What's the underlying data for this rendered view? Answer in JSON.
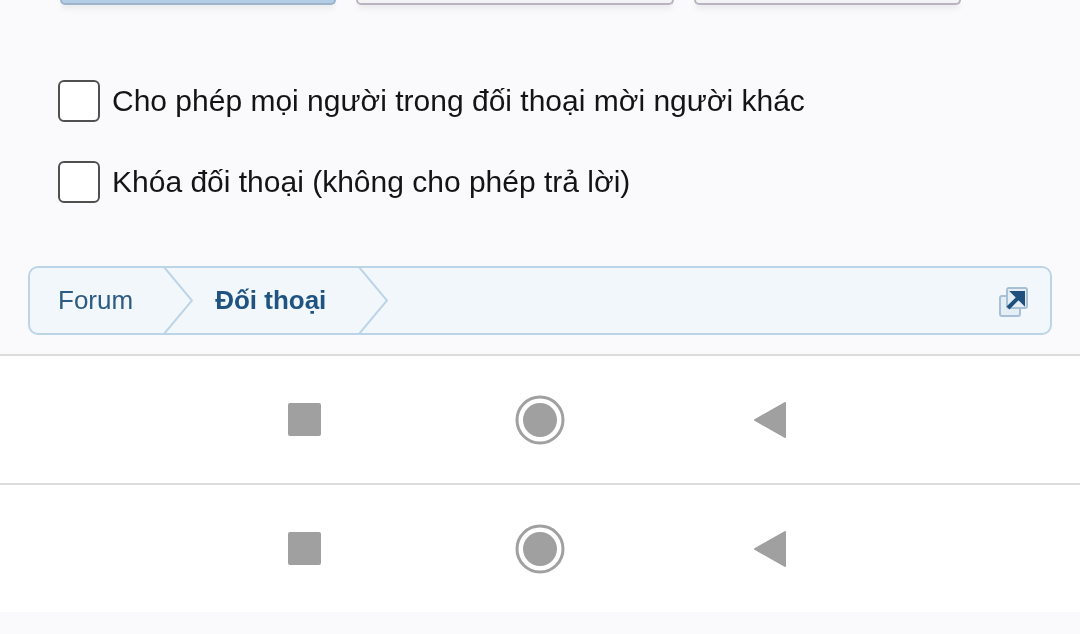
{
  "top_buttons": [
    {
      "selected": true
    },
    {
      "selected": false
    },
    {
      "selected": false
    }
  ],
  "options": [
    {
      "label": "Cho phép mọi người trong đối thoại mời người khác",
      "checked": false
    },
    {
      "label": "Khóa đối thoại (không cho phép trả lời)",
      "checked": false
    }
  ],
  "breadcrumb": [
    {
      "label": "Forum",
      "selected": false
    },
    {
      "label": "Đối thoại",
      "selected": true
    }
  ],
  "nav_bars": [
    {
      "kind": "nav"
    },
    {
      "kind": "nav"
    }
  ]
}
